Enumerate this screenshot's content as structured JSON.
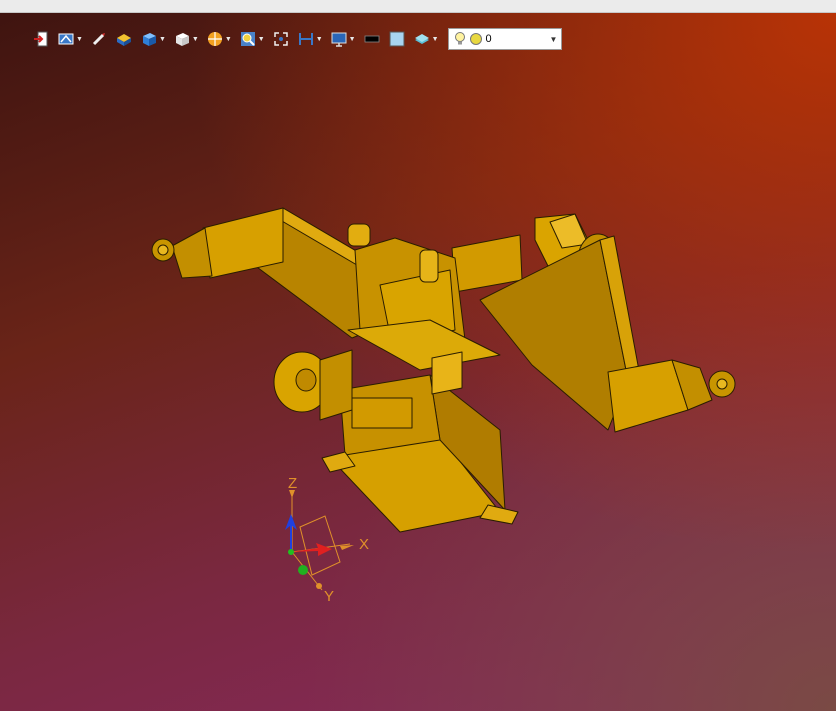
{
  "toolbar": {
    "items": [
      {
        "icon": "exit-icon"
      },
      {
        "icon": "view-orientation-icon"
      },
      {
        "icon": "sketch-icon"
      },
      {
        "icon": "display-style-icon"
      },
      {
        "icon": "shaded-cube-icon"
      },
      {
        "icon": "wireframe-cube-icon"
      },
      {
        "icon": "section-icon"
      },
      {
        "icon": "zoom-icon"
      },
      {
        "icon": "fit-icon"
      },
      {
        "icon": "measure-icon"
      },
      {
        "icon": "screen-capture-icon"
      },
      {
        "icon": "black-color-icon"
      },
      {
        "icon": "light-blue-color-icon"
      },
      {
        "icon": "layer-icon"
      }
    ],
    "layer_select": {
      "value": "0"
    }
  },
  "triad": {
    "x_label": "X",
    "y_label": "Y",
    "z_label": "Z"
  },
  "colors": {
    "model": "#d29a00",
    "edge": "#2a1d00",
    "background_top_right": "#b83306",
    "background_bottom_left": "#8a2a62"
  }
}
